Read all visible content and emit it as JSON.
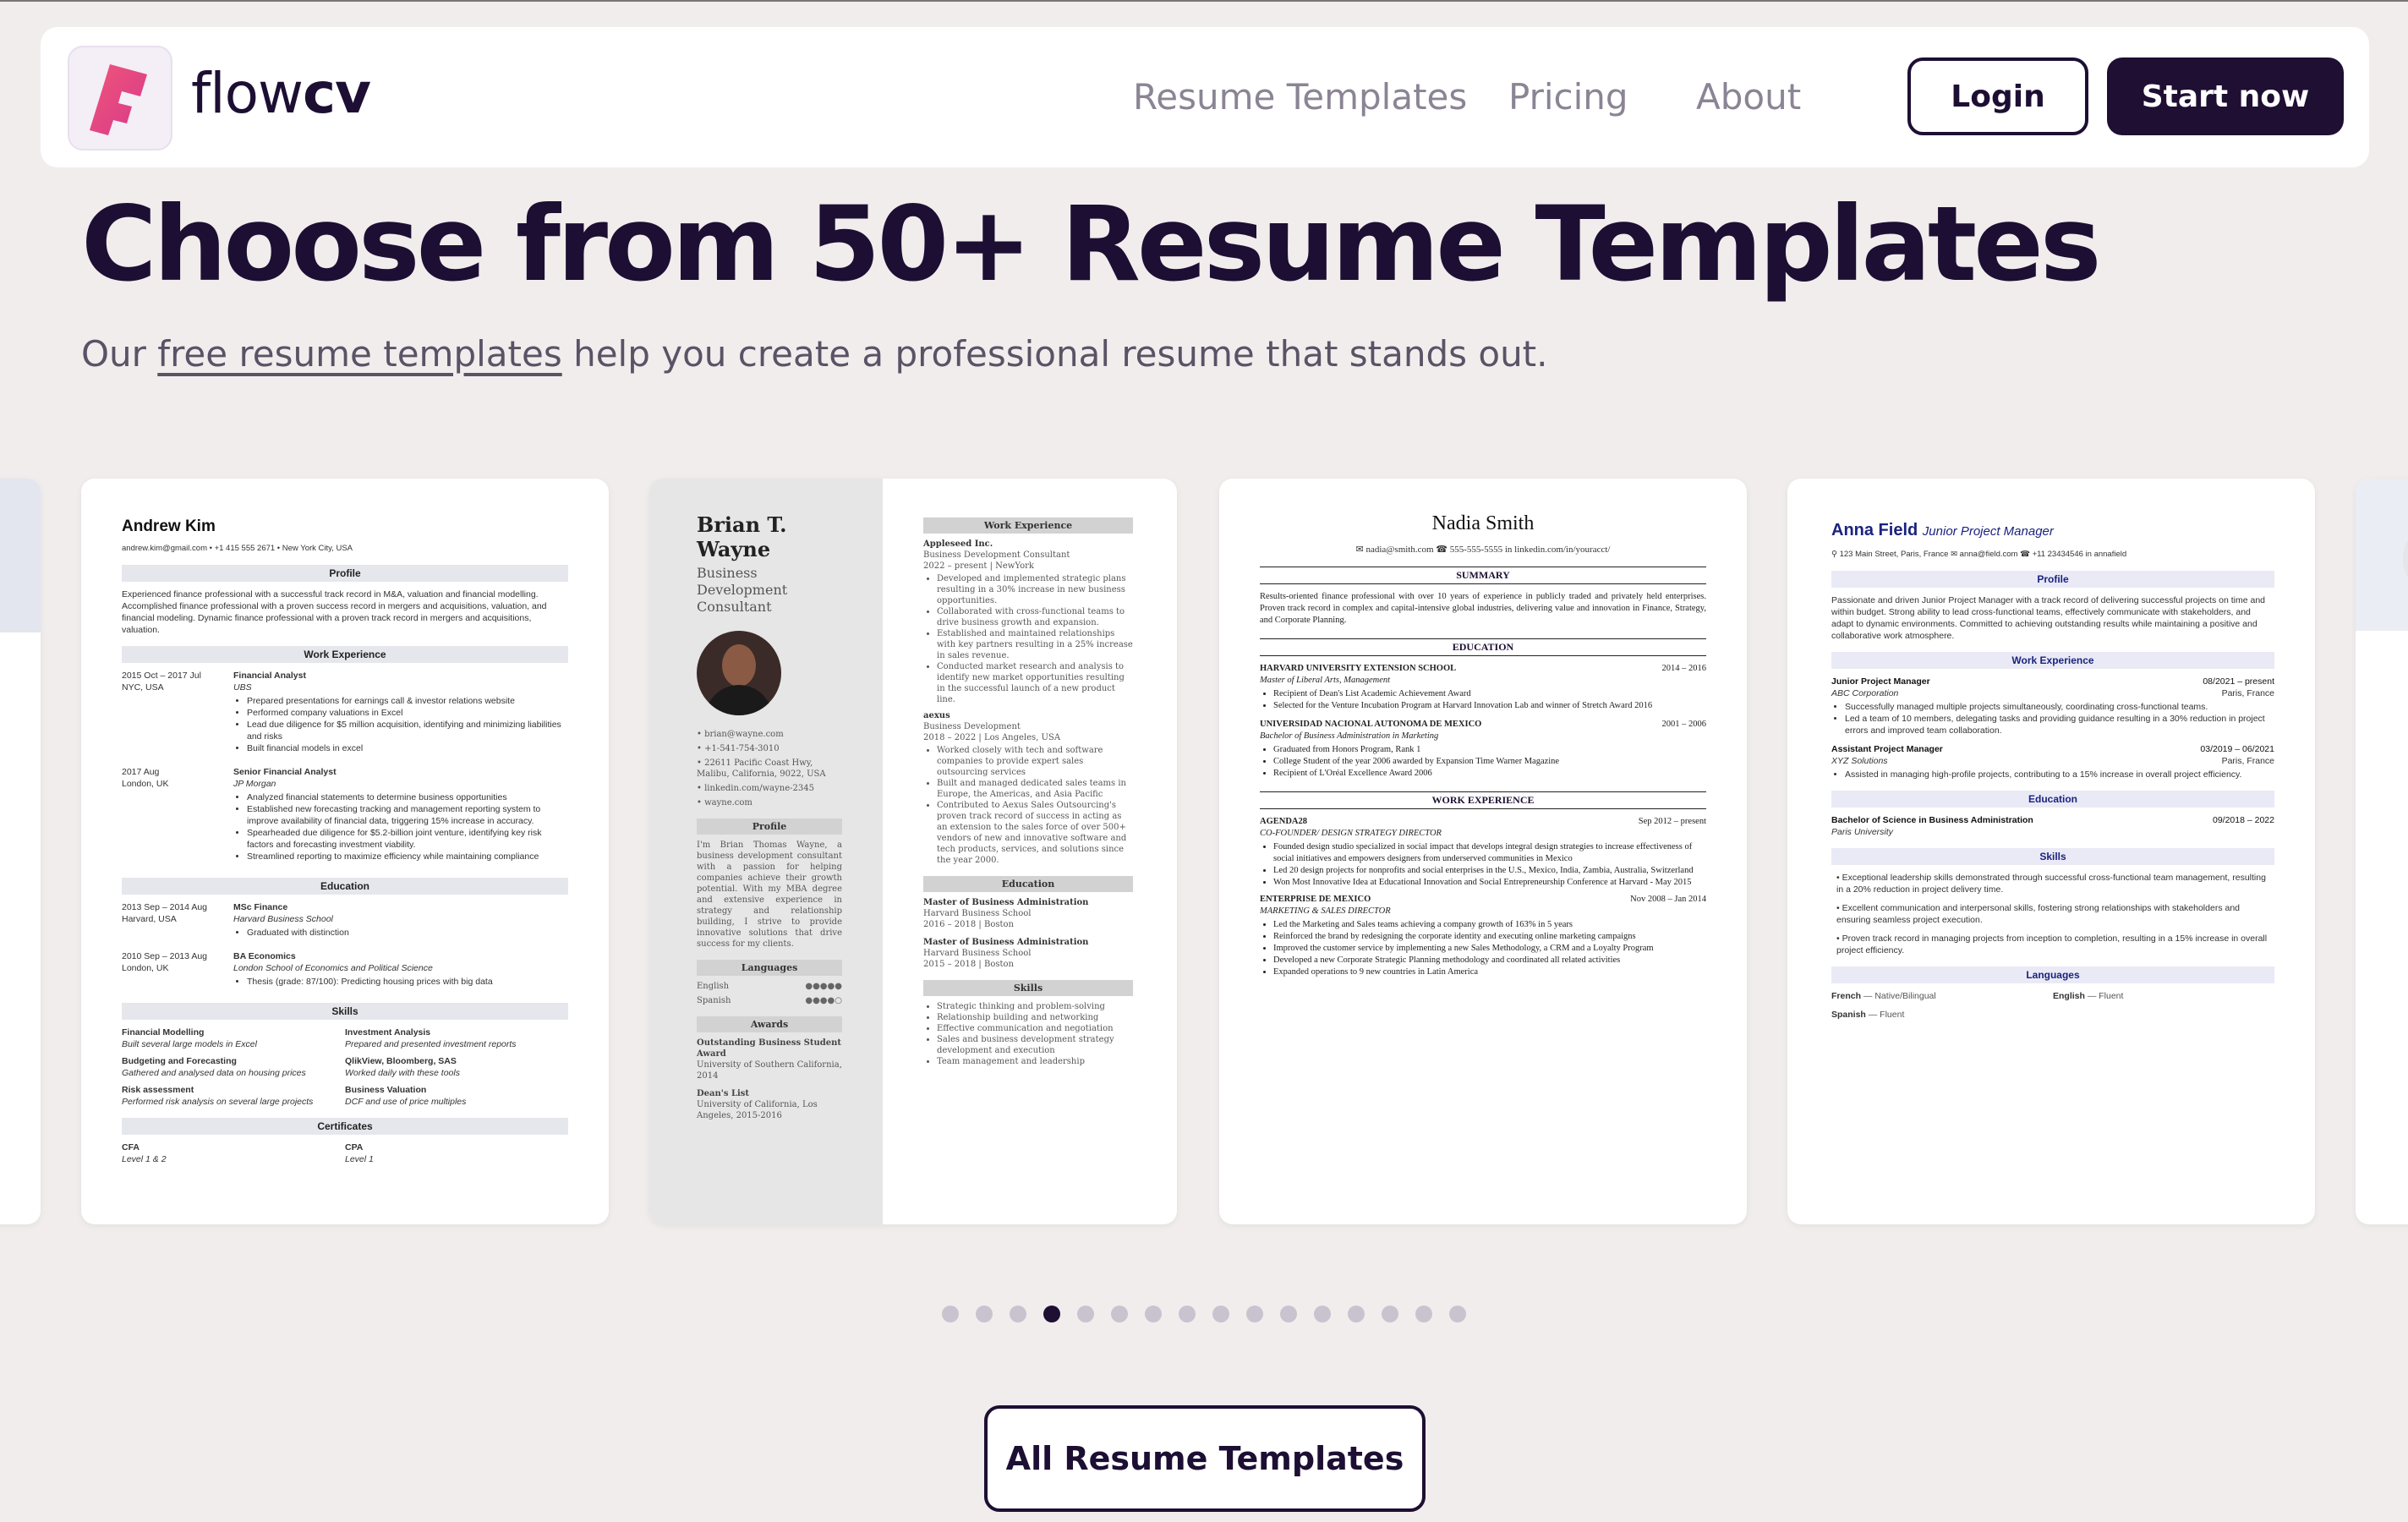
{
  "nav": {
    "logo": {
      "prefix": "flow",
      "suffix": "cv"
    },
    "links": [
      "Resume Templates",
      "Pricing",
      "About"
    ],
    "login": "Login",
    "start": "Start now"
  },
  "hero": {
    "headline": "Choose from 50+ Resume Templates",
    "sub_before": "Our ",
    "sub_link": "free resume templates",
    "sub_after": " help you create a professional resume that stands out."
  },
  "card1": {
    "name": "Andrew Kim",
    "contact": "andrew.kim@gmail.com  •  +1 415 555 2671  •  New York City, USA",
    "profile_h": "Profile",
    "profile": "Experienced finance professional with a successful track record in M&A, valuation and financial modelling. Accomplished finance professional with a proven success record in mergers and acquisitions, valuation, and financial modeling. Dynamic finance professional with a proven track record in mergers and acquisitions, valuation.",
    "work_h": "Work Experience",
    "jobs": [
      {
        "date": "2015 Oct – 2017 Jul",
        "loc": "NYC, USA",
        "title": "Financial Analyst",
        "company": "UBS",
        "bullets": [
          "Prepared presentations for earnings call & investor relations website",
          "Performed company valuations in Excel",
          "Lead due diligence for $5 million acquisition, identifying and minimizing liabilities and risks",
          "Built financial models in excel"
        ]
      },
      {
        "date": "2017 Aug",
        "loc": "London, UK",
        "title": "Senior Financial Analyst",
        "company": "JP Morgan",
        "bullets": [
          "Analyzed financial statements to determine business opportunities",
          "Established new forecasting tracking and management reporting system to improve availability of financial data, triggering 15% increase in accuracy.",
          "Spearheaded due diligence for $5.2-billion joint venture, identifying key risk factors and forecasting investment viability.",
          "Streamlined reporting to maximize efficiency while maintaining compliance"
        ]
      }
    ],
    "edu_h": "Education",
    "edu": [
      {
        "date": "2013 Sep – 2014 Aug",
        "loc": "Harvard, USA",
        "title": "MSc Finance",
        "school": "Harvard Business School",
        "note": "Graduated with distinction"
      },
      {
        "date": "2010 Sep – 2013 Aug",
        "loc": "London, UK",
        "title": "BA Economics",
        "school": "London School of Economics and Political Science",
        "note": "Thesis (grade: 87/100): Predicting housing prices with big data"
      }
    ],
    "skills_h": "Skills",
    "skills": [
      {
        "t": "Financial Modelling",
        "d": "Built several large models in Excel"
      },
      {
        "t": "Investment Analysis",
        "d": "Prepared and presented investment reports"
      },
      {
        "t": "Budgeting and Forecasting",
        "d": "Gathered and analysed data on housing prices"
      },
      {
        "t": "QlikView, Bloomberg, SAS",
        "d": "Worked daily with these tools"
      },
      {
        "t": "Risk assessment",
        "d": "Performed risk analysis on several large projects"
      },
      {
        "t": "Business Valuation",
        "d": "DCF and use of price multiples"
      }
    ],
    "cert_h": "Certificates",
    "certs": [
      {
        "t": "CFA",
        "d": "Level 1 & 2"
      },
      {
        "t": "CPA",
        "d": "Level 1"
      }
    ]
  },
  "card2": {
    "name": "Brian T. Wayne",
    "role": "Business Development Consultant",
    "contacts": [
      "brian@wayne.com",
      "+1-541-754-3010",
      "22611 Pacific Coast Hwy, Malibu, California, 9022, USA",
      "linkedin.com/wayne-2345",
      "wayne.com"
    ],
    "profile_h": "Profile",
    "profile": "I'm Brian Thomas Wayne, a business development consultant with a passion for helping companies achieve their growth potential. With my MBA degree and extensive experience in strategy and relationship building, I strive to provide innovative solutions that drive success for my clients.",
    "lang_h": "Languages",
    "langs": [
      {
        "l": "English",
        "d": "●●●●●"
      },
      {
        "l": "Spanish",
        "d": "●●●●○"
      }
    ],
    "awards_h": "Awards",
    "awards": [
      {
        "t": "Outstanding Business Student Award",
        "d": "University of Southern California, 2014"
      },
      {
        "t": "Dean's List",
        "d": "University of California, Los Angeles, 2015-2016"
      }
    ],
    "work_h": "Work Experience",
    "jobs": [
      {
        "t": "Appleseed Inc.",
        "d": "Business Development Consultant\n2022 – present | NewYork",
        "bullets": [
          "Developed and implemented strategic plans resulting in a 30% increase in new business opportunities.",
          "Collaborated with cross-functional teams to drive business growth and expansion.",
          "Established and maintained relationships with key partners resulting in a 25% increase in sales revenue.",
          "Conducted market research and analysis to identify new market opportunities resulting in the successful launch of a new product line."
        ]
      },
      {
        "t": "aexus",
        "d": "Business Development\n2018 – 2022 | Los Angeles, USA",
        "bullets": [
          "Worked closely with tech and software companies to provide expert sales outsourcing services",
          "Built and managed dedicated sales teams in Europe, the Americas, and Asia Pacific",
          "Contributed to Aexus Sales Outsourcing's proven track record of success in acting as an extension to the sales force of over 500+ vendors of new and innovative software and tech products, services, and solutions since the year 2000."
        ]
      }
    ],
    "edu_h": "Education",
    "edu": [
      {
        "t": "Master of Business Administration",
        "d": "Harvard Business School\n2016 – 2018 | Boston"
      },
      {
        "t": "Master of Business Administration",
        "d": "Harvard Business School\n2015 – 2018 | Boston"
      }
    ],
    "skills_h": "Skills",
    "skills": [
      "Strategic thinking and problem-solving",
      "Relationship building and networking",
      "Effective communication and negotiation",
      "Sales and business development strategy development and execution",
      "Team management and leadership"
    ]
  },
  "card3": {
    "name": "Nadia Smith",
    "contact": "✉ nadia@smith.com   ☎ 555-555-5555   in linkedin.com/in/youracct/",
    "summary_h": "SUMMARY",
    "summary": "Results-oriented finance professional with over 10 years of experience in publicly traded and privately held enterprises. Proven track record in complex and capital-intensive global industries, delivering value and innovation in Finance, Strategy, and Corporate Planning.",
    "edu_h": "EDUCATION",
    "edu": [
      {
        "t": "HARVARD UNIVERSITY EXTENSION SCHOOL",
        "date": "2014 – 2016",
        "deg": "Master of Liberal Arts, Management",
        "bullets": [
          "Recipient of Dean's List Academic Achievement Award",
          "Selected for the Venture Incubation Program at Harvard Innovation Lab and winner of Stretch Award 2016"
        ]
      },
      {
        "t": "UNIVERSIDAD NACIONAL AUTONOMA DE MEXICO",
        "date": "2001 – 2006",
        "deg": "Bachelor of Business Administration in Marketing",
        "bullets": [
          "Graduated from Honors Program, Rank 1",
          "College Student of the year 2006 awarded by Expansion Time Warner Magazine",
          "Recipient of L'Oréal Excellence Award 2006"
        ]
      }
    ],
    "work_h": "WORK EXPERIENCE",
    "jobs": [
      {
        "t": "AGENDA28",
        "date": "Sep 2012 – present",
        "role": "CO-FOUNDER/ DESIGN STRATEGY DIRECTOR",
        "bullets": [
          "Founded design studio specialized in social impact that develops integral design strategies to increase effectiveness of social initiatives and empowers designers from underserved communities in Mexico",
          "Led 20 design projects for nonprofits and social enterprises in the U.S., Mexico, India, Zambia, Australia, Switzerland",
          "Won Most Innovative Idea at Educational Innovation and Social Entrepreneurship Conference at Harvard - May 2015"
        ]
      },
      {
        "t": "ENTERPRISE DE MEXICO",
        "date": "Nov 2008 – Jan 2014",
        "role": "MARKETING & SALES DIRECTOR",
        "bullets": [
          "Led the Marketing and Sales teams achieving a company growth of 163% in 5 years",
          "Reinforced the brand by redesigning the corporate identity and executing online marketing campaigns",
          "Improved the customer service by implementing a new Sales Methodology, a CRM and a Loyalty Program",
          "Developed a new Corporate Strategic Planning methodology and coordinated all related activities",
          "Expanded operations to 9 new countries in Latin America"
        ]
      }
    ]
  },
  "card4": {
    "name": "Anna Field",
    "title": "Junior Project Manager",
    "contact": "⚲ 123 Main Street, Paris, France   ✉ anna@field.com   ☎ +11 23434546   in annafield",
    "profile_h": "Profile",
    "profile": "Passionate and driven Junior Project Manager with a track record of delivering successful projects on time and within budget. Strong ability to lead cross-functional teams, effectively communicate with stakeholders, and adapt to dynamic environments. Committed to achieving outstanding results while maintaining a positive and collaborative work atmosphere.",
    "work_h": "Work Experience",
    "jobs": [
      {
        "t": "Junior Project Manager",
        "date": "08/2021 – present",
        "co": "ABC Corporation",
        "loc": "Paris, France",
        "bullets": [
          "Successfully managed multiple projects simultaneously, coordinating cross-functional teams.",
          "Led a team of 10 members, delegating tasks and providing guidance resulting in a 30% reduction in project errors and improved team collaboration."
        ]
      },
      {
        "t": "Assistant Project Manager",
        "date": "03/2019 – 06/2021",
        "co": "XYZ Solutions",
        "loc": "Paris, France",
        "bullets": [
          "Assisted in managing high-profile projects, contributing to a 15% increase in overall project efficiency."
        ]
      }
    ],
    "edu_h": "Education",
    "edu": {
      "t": "Bachelor of Science in Business Administration",
      "date": "09/2018 – 2022",
      "school": "Paris University"
    },
    "skills_h": "Skills",
    "skills": [
      "Exceptional leadership skills demonstrated through successful cross-functional team management, resulting in a 20% reduction in project delivery time.",
      "Excellent communication and interpersonal skills, fostering strong relationships with stakeholders and ensuring seamless project execution.",
      "Proven track record in managing projects from inception to completion, resulting in a 15% increase in overall project efficiency."
    ],
    "lang_h": "Languages",
    "langs": [
      {
        "l": "French",
        "d": "Native/Bilingual"
      },
      {
        "l": "English",
        "d": "Fluent"
      },
      {
        "l": "Spanish",
        "d": "Fluent"
      }
    ]
  },
  "carousel": {
    "dot_count": 16,
    "active_index": 3
  },
  "cta": {
    "all_templates": "All Resume Templates"
  },
  "colors": {
    "brand_dark": "#1e0f33",
    "background": "#f1eded",
    "logo_pink": "#e8476f"
  }
}
